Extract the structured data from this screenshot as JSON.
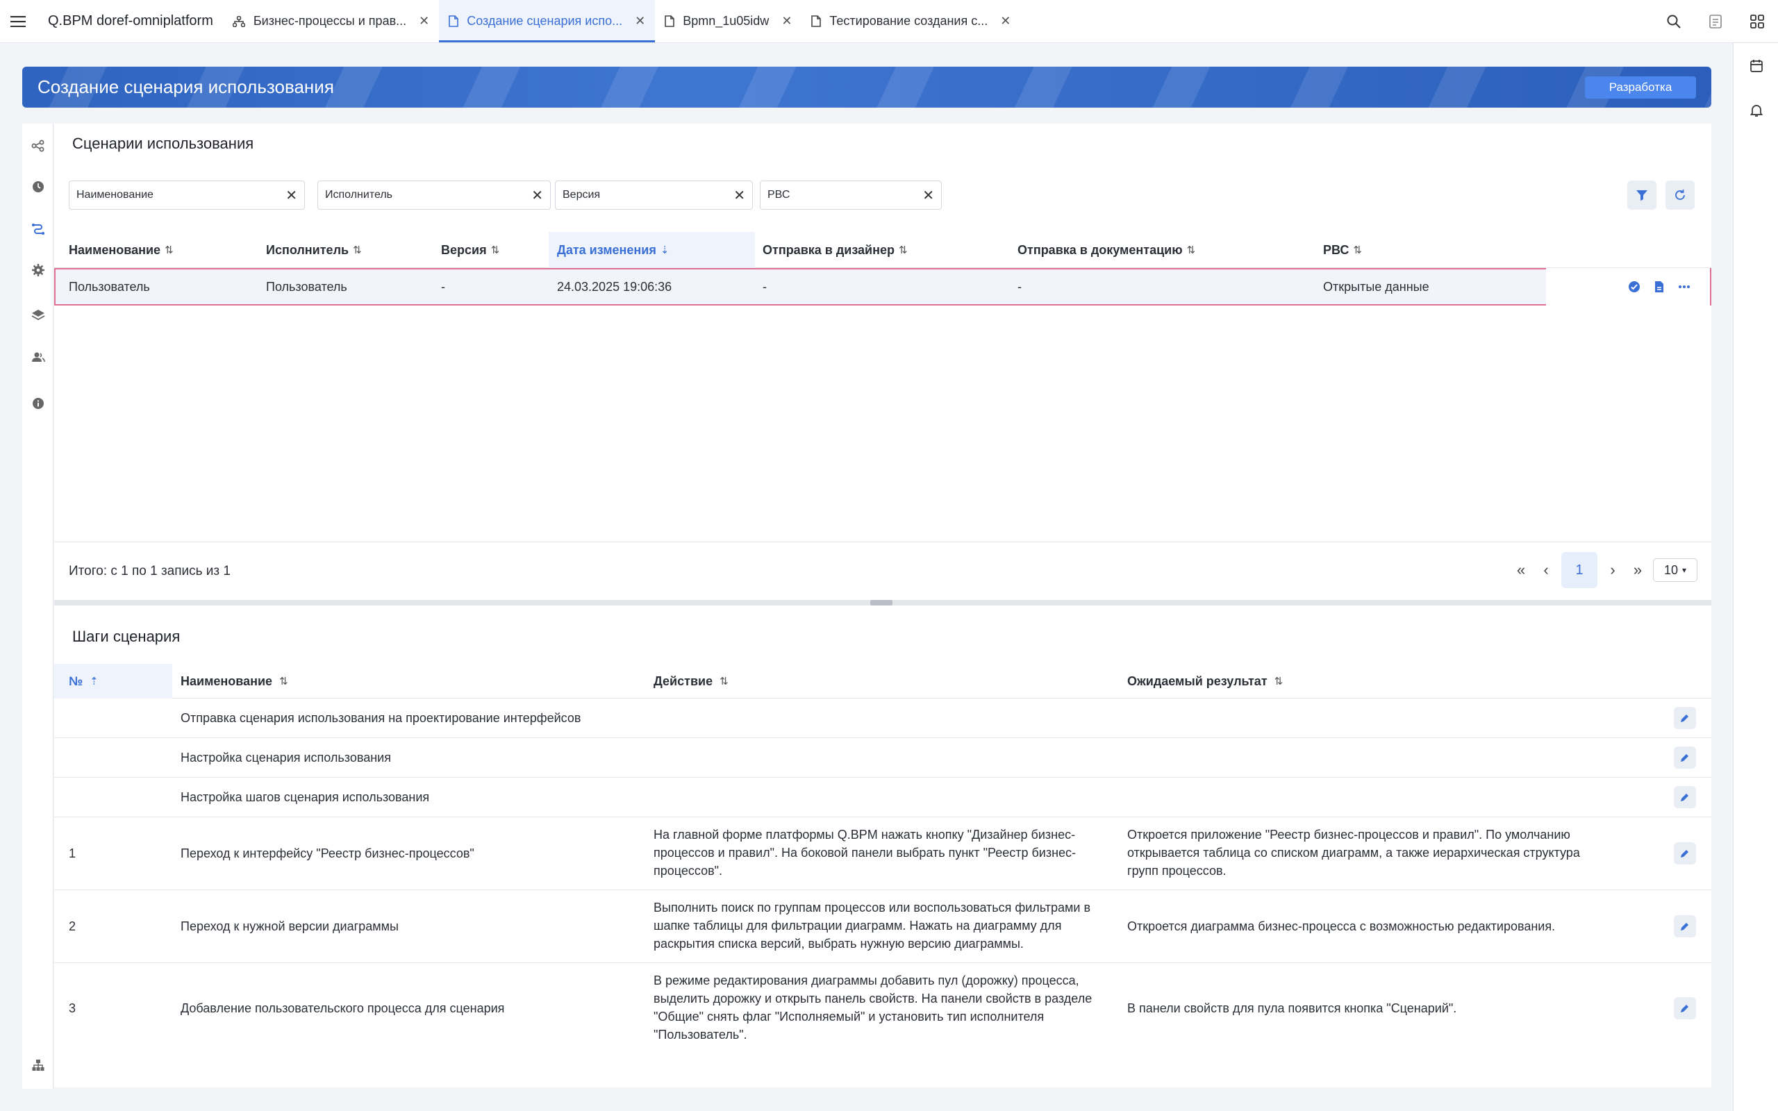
{
  "app": {
    "title": "Q.BPM doref-omniplatform"
  },
  "tabs": [
    {
      "label": "Бизнес-процессы и прав...",
      "icon": "network-icon"
    },
    {
      "label": "Создание сценария испо...",
      "icon": "document-icon",
      "active": true
    },
    {
      "label": "Bpmn_1u05idw",
      "icon": "document-icon"
    },
    {
      "label": "Тестирование создания с...",
      "icon": "document-icon"
    }
  ],
  "header": {
    "title": "Создание сценария использования",
    "env_badge": "Разработка"
  },
  "scenarios": {
    "title": "Сценарии использования",
    "filters": [
      "Наименование",
      "Исполнитель",
      "Версия",
      "РВС"
    ],
    "columns": [
      "Наименование",
      "Исполнитель",
      "Версия",
      "Дата изменения",
      "Отправка в дизайнер",
      "Отправка в документацию",
      "РВС"
    ],
    "sorted_column": "Дата изменения",
    "rows": [
      {
        "name": "Пользователь",
        "executor": "Пользователь",
        "version": "-",
        "modified": "24.03.2025 19:06:36",
        "to_designer": "-",
        "to_docs": "-",
        "rvs": "Открытые данные"
      }
    ],
    "total": "Итого: с 1 по 1 запись из 1",
    "pagination": {
      "current_page": "1",
      "page_size": "10"
    }
  },
  "steps": {
    "title": "Шаги сценария",
    "columns": [
      "№",
      "Наименование",
      "Действие",
      "Ожидаемый результат"
    ],
    "sorted_column": "№",
    "rows": [
      {
        "num": "",
        "name": "Отправка сценария использования на проектирование интерфейсов",
        "action": "",
        "result": ""
      },
      {
        "num": "",
        "name": "Настройка сценария использования",
        "action": "",
        "result": ""
      },
      {
        "num": "",
        "name": "Настройка шагов сценария использования",
        "action": "",
        "result": ""
      },
      {
        "num": "1",
        "name": "Переход к интерфейсу \"Реестр бизнес-процессов\"",
        "action": "На главной форме платформы Q.BPM нажать кнопку \"Дизайнер бизнес-процессов и правил\". На боковой панели выбрать пункт \"Реестр бизнес-процессов\".",
        "result": "Откроется приложение \"Реестр бизнес-процессов и правил\". По умолчанию открывается таблица со списком диаграмм, а также иерархическая структура групп процессов."
      },
      {
        "num": "2",
        "name": "Переход к нужной версии диаграммы",
        "action": "Выполнить поиск по группам процессов или воспользоваться фильтрами в шапке таблицы для фильтрации диаграмм. Нажать на диаграмму для раскрытия списка версий, выбрать нужную версию диаграммы.",
        "result": "Откроется диаграмма бизнес-процесса с возможностью редактирования."
      },
      {
        "num": "3",
        "name": "Добавление пользовательского процесса для сценария",
        "action": "В режиме редактирования диаграммы добавить пул (дорожку) процесса, выделить дорожку и открыть панель свойств. На панели свойств в разделе \"Общие\" снять флаг \"Исполняемый\" и установить тип исполнителя \"Пользователь\".",
        "result": "В панели свойств для пула появится кнопка \"Сценарий\"."
      }
    ]
  },
  "colors": {
    "accent": "#3a6fd6",
    "banner": "#2f64c0",
    "badge": "#4a86ee",
    "selected_row_border": "#e06e92"
  }
}
